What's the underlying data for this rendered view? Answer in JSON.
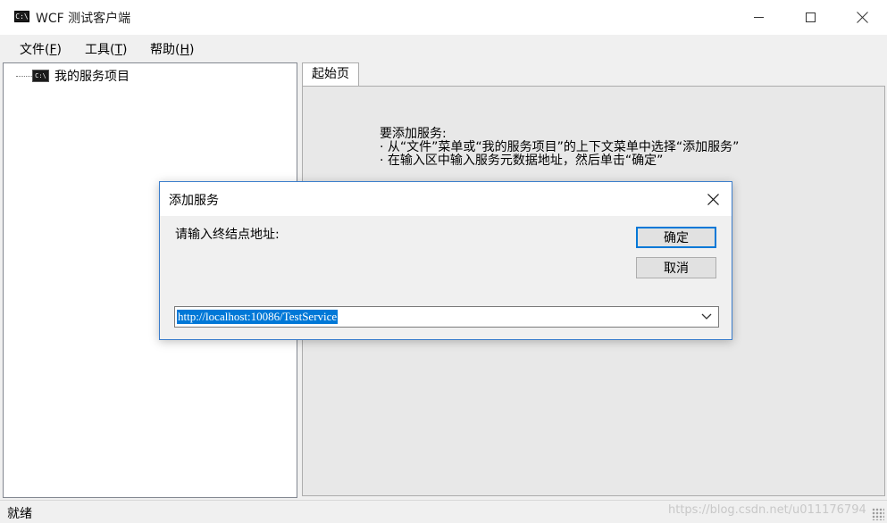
{
  "window": {
    "title": "WCF 测试客户端",
    "icon_text": "C:\\"
  },
  "menu": {
    "file": {
      "label": "文件(",
      "key": "F",
      "end": ")"
    },
    "tools": {
      "label": "工具(",
      "key": "T",
      "end": ")"
    },
    "help": {
      "label": "帮助(",
      "key": "H",
      "end": ")"
    }
  },
  "tree": {
    "root_label": "我的服务项目",
    "icon_text": "C:\\"
  },
  "tabs": {
    "start": "起始页"
  },
  "start_page": {
    "line1": "要添加服务:",
    "line2": "·  从“文件”菜单或“我的服务项目”的上下文菜单中选择“添加服务”",
    "line3": "·  在输入区中输入服务元数据地址，然后单击“确定”"
  },
  "dialog": {
    "title": "添加服务",
    "prompt": "请输入终结点地址:",
    "ok_label": "确定",
    "cancel_label": "取消",
    "url_value": "http://localhost:10086/TestService"
  },
  "status": {
    "text": "就绪",
    "watermark": "https://blog.csdn.net/u011176794"
  },
  "colors": {
    "accent": "#0078d7",
    "dialog_border": "#3a7dcc"
  }
}
